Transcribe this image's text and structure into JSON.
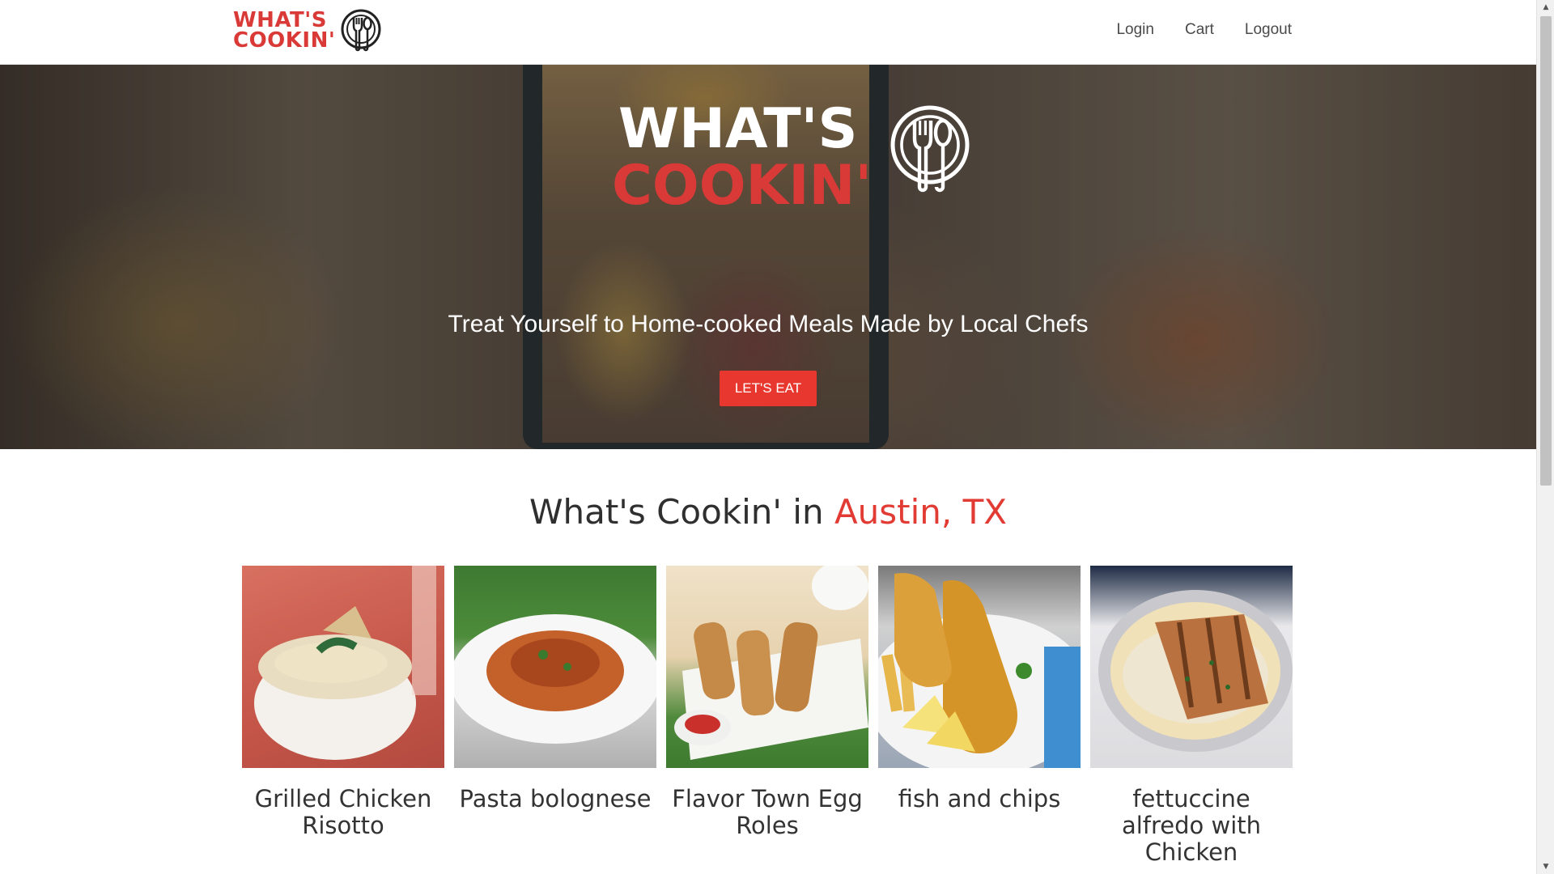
{
  "brand": {
    "name_line1": "WHAT'S",
    "name_line2": "COOKIN'",
    "accent_color": "#d93a37",
    "logo_icon": "fork-spoon-plate-icon"
  },
  "nav": {
    "links": [
      {
        "label": "Login"
      },
      {
        "label": "Cart"
      },
      {
        "label": "Logout"
      }
    ]
  },
  "hero": {
    "logo_line1": "WHAT'S",
    "logo_line2": "COOKIN'",
    "tagline": "Treat Yourself to Home-cooked Meals Made by Local Chefs",
    "cta_label": "LET'S EAT",
    "cta_color": "#e8372f"
  },
  "section": {
    "title_prefix": "What's Cookin' in ",
    "city": "Austin, TX"
  },
  "meals": [
    {
      "name": "Grilled Chicken Risotto"
    },
    {
      "name": "Pasta bolognese"
    },
    {
      "name": "Flavor Town Egg Roles"
    },
    {
      "name": "fish and chips"
    },
    {
      "name": "fettuccine alfredo with Chicken"
    }
  ]
}
